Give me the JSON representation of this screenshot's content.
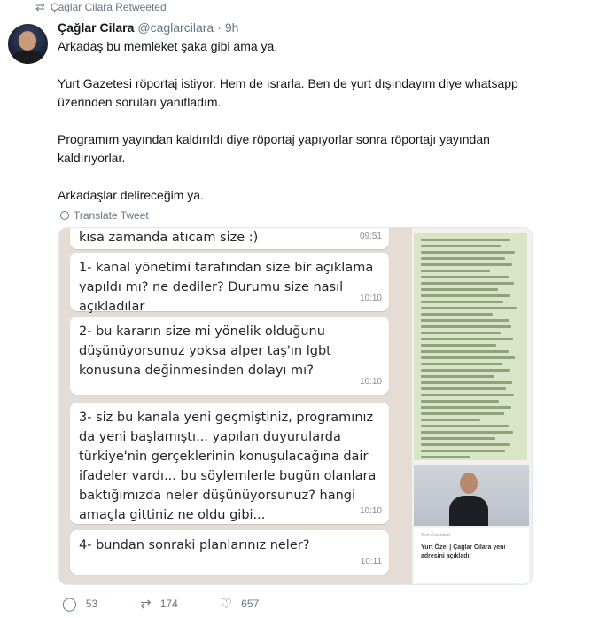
{
  "retweet_notice": "Çağlar Cilara Retweeted",
  "author": {
    "name": "Çağlar Cilara",
    "handle": "@caglarcilara",
    "separator": "·",
    "time": "9h"
  },
  "tweet": {
    "paragraphs": [
      "Arkadaş bu memleket şaka gibi ama ya.",
      "Yurt Gazetesi röportaj istiyor. Hem de ısrarla. Ben de yurt dışındayım diye whatsapp üzerinden soruları yanıtladım.",
      "Programım yayından kaldırıldı diye röportaj yapıyorlar sonra röportajı yayından kaldırıyorlar.",
      "Arkadaşlar delireceğim ya."
    ]
  },
  "translate_label": "Translate Tweet",
  "chat": {
    "messages": [
      {
        "text": "kısa zamanda atıcam size :)",
        "time": "09:51"
      },
      {
        "text": "1- kanal yönetimi tarafından size bir açıklama yapıldı mı? ne dediler? Durumu size nasıl açıkladılar",
        "time": "10:10"
      },
      {
        "text": "2- bu kararın size mi yönelik olduğunu düşünüyorsunuz yoksa alper taş'ın lgbt konusuna değinmesinden dolayı mı?",
        "time": "10:10"
      },
      {
        "text": "3- siz bu kanala yeni geçmiştiniz, programınız da yeni başlamıştı... yapılan duyurularda türkiye'nin gerçeklerinin konuşulacağına dair ifadeler vardı... bu söylemlerle bugün olanlara baktığımızda neler düşünüyorsunuz? hangi amaçla gittiniz ne oldu gibi...",
        "time": "10:10"
      },
      {
        "text": "4- bundan sonraki planlarınız neler?",
        "time": "10:11"
      }
    ]
  },
  "side_card": {
    "source": "Yurt Gazetesi",
    "title": "Yurt Özel | Çağlar Cilara yeni adresini açıkladı!"
  },
  "actions": {
    "replies": "53",
    "retweets": "174",
    "likes": "657"
  }
}
